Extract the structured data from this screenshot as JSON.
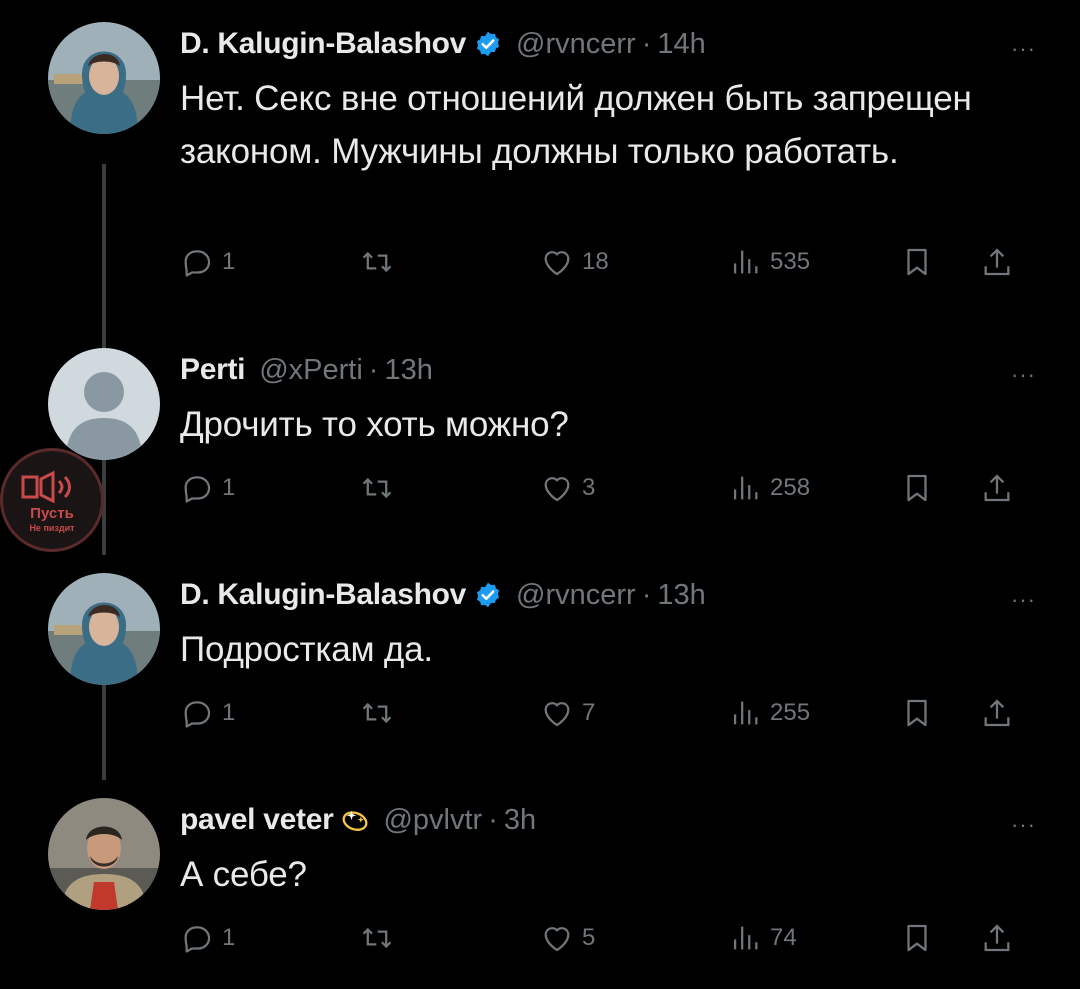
{
  "tweets": [
    {
      "name": "D. Kalugin-Balashov",
      "handle": "@rvncerr",
      "dot": "·",
      "time": "14h",
      "text": "Нет. Секс вне отношений должен быть запрещен законом. Мужчины должны только работать.",
      "replies": "1",
      "likes": "18",
      "views": "535",
      "more": "···"
    },
    {
      "name": "Perti",
      "handle": "@xPerti",
      "dot": "·",
      "time": "13h",
      "text": "Дрочить то хоть можно?",
      "replies": "1",
      "likes": "3",
      "views": "258",
      "more": "···"
    },
    {
      "name": "D. Kalugin-Balashov",
      "handle": "@rvncerr",
      "dot": "·",
      "time": "13h",
      "text": "Подросткам да.",
      "replies": "1",
      "likes": "7",
      "views": "255",
      "more": "···"
    },
    {
      "name": "pavel veter",
      "handle": "@pvlvtr",
      "dot": "·",
      "time": "3h",
      "text": "А себе?",
      "replies": "1",
      "likes": "5",
      "views": "74",
      "more": "···"
    }
  ],
  "watermark": {
    "line1": "Пусть",
    "line2": "Не пиздит"
  },
  "colors": {
    "background": "#000000",
    "text": "#e7e9ea",
    "muted": "#71767b",
    "verified": "#1d9bf0",
    "thread_line": "#3a3d40"
  },
  "icons": {
    "reply": "reply-icon",
    "retweet": "retweet-icon",
    "like": "heart-icon",
    "views": "views-icon",
    "bookmark": "bookmark-icon",
    "share": "share-icon",
    "more": "more-icon",
    "verified": "verified-badge-icon",
    "sparkle": "sparkle-badge-icon"
  }
}
